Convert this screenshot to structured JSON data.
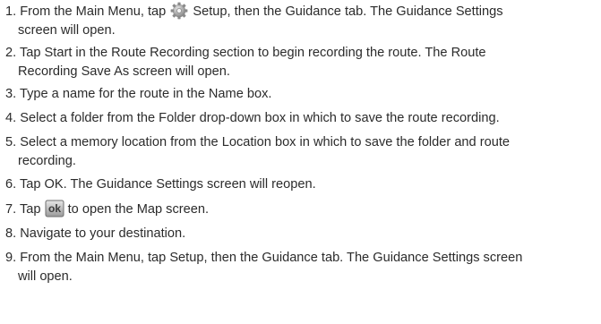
{
  "steps": [
    {
      "number": "1.",
      "lines": [
        {
          "before": "From the Main Menu, tap ",
          "icon": "setup-gear-icon",
          "after": " Setup, then the Guidance tab. The Guidance Settings"
        },
        {
          "text": "screen will open."
        }
      ]
    },
    {
      "number": "2.",
      "lines": [
        {
          "text": "Tap Start in the Route Recording section to begin recording the route. The Route"
        },
        {
          "text": "Recording Save As screen will open."
        }
      ]
    },
    {
      "number": "3.",
      "lines": [
        {
          "text": "Type a name for the route in the Name box."
        }
      ]
    },
    {
      "number": "4.",
      "lines": [
        {
          "text": "Select a folder from the Folder drop-down box in which to save the route recording."
        }
      ]
    },
    {
      "number": "5.",
      "lines": [
        {
          "text": "Select a memory location from the Location box in which to save the folder and route"
        },
        {
          "text": "recording."
        }
      ]
    },
    {
      "number": "6.",
      "lines": [
        {
          "text": "Tap OK. The Guidance Settings screen will reopen."
        }
      ]
    },
    {
      "number": "7.",
      "lines": [
        {
          "before": "Tap ",
          "icon": "ok-button-icon",
          "icon_label": "ok",
          "after": " to open the Map screen."
        }
      ]
    },
    {
      "number": "8.",
      "lines": [
        {
          "text": "Navigate to your destination."
        }
      ]
    },
    {
      "number": "9.",
      "lines": [
        {
          "text": "From the Main Menu, tap Setup, then the Guidance tab. The Guidance Settings screen"
        },
        {
          "text": "will open."
        }
      ]
    }
  ]
}
